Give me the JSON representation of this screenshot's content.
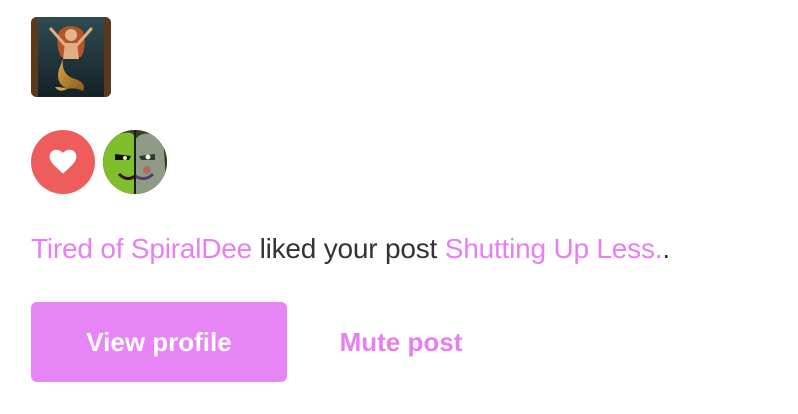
{
  "notification": {
    "actor_name": "Tired of SpiralDee",
    "action_text": " liked your post ",
    "post_title": "Shutting Up Less.",
    "trailing": ".",
    "accent_color": "#e77ff3",
    "like_color": "#ee5c5c"
  },
  "icons": {
    "like": "heart-icon"
  },
  "actions": {
    "view_profile_label": "View profile",
    "mute_post_label": "Mute post"
  }
}
